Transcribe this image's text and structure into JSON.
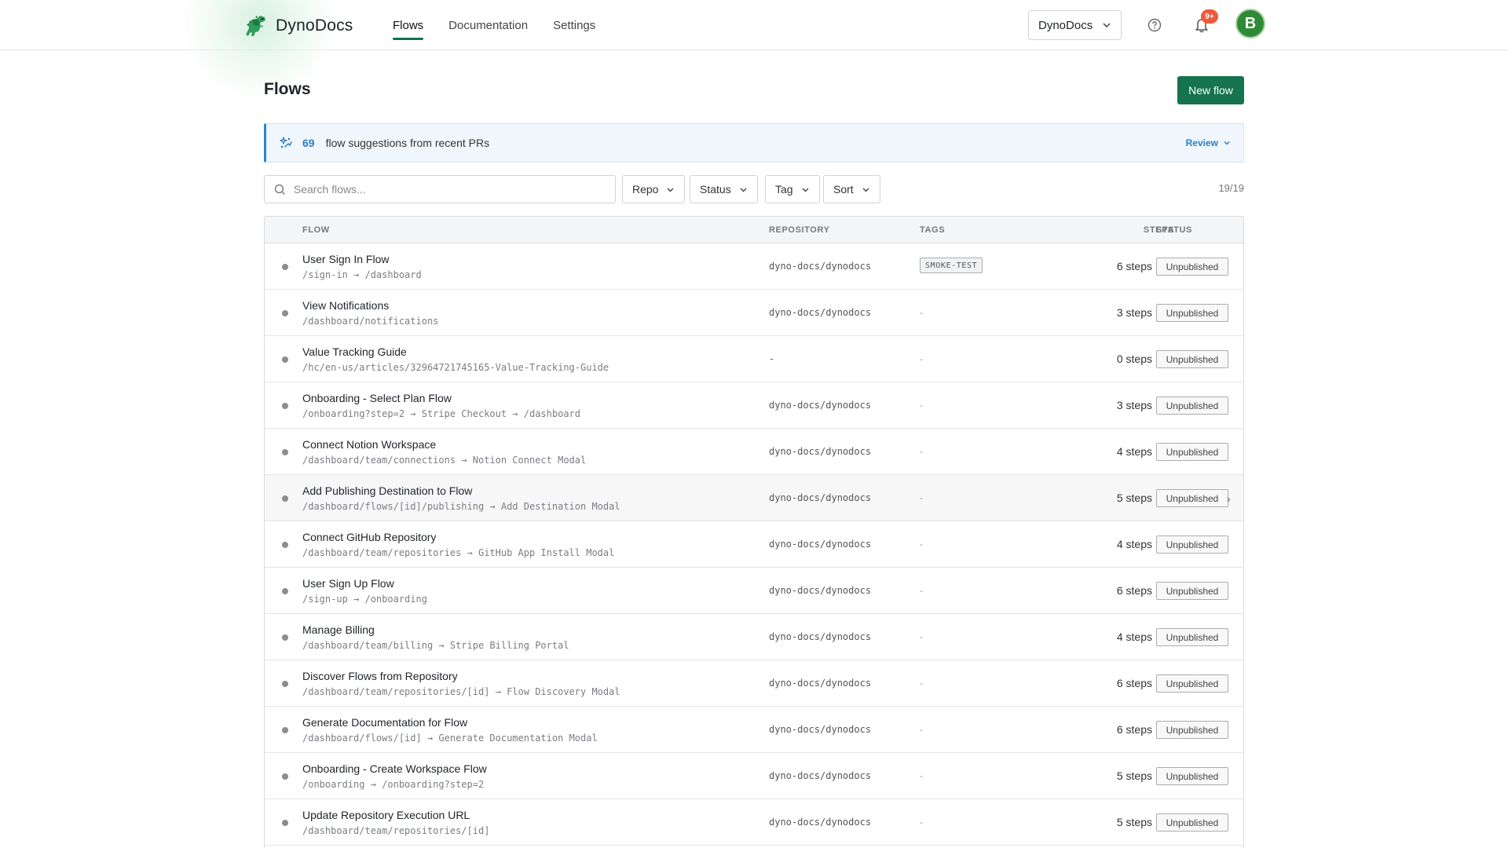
{
  "app": {
    "name": "DynoDocs"
  },
  "nav": {
    "items": [
      {
        "label": "Flows",
        "active": true
      },
      {
        "label": "Documentation",
        "active": false
      },
      {
        "label": "Settings",
        "active": false
      }
    ]
  },
  "header": {
    "workspace": "DynoDocs",
    "notification_badge": "9+",
    "avatar_initial": "B",
    "accent_color": "#157350"
  },
  "page": {
    "title": "Flows",
    "new_flow_label": "New flow"
  },
  "banner": {
    "count": "69",
    "text": "flow suggestions from recent PRs",
    "action": "Review"
  },
  "toolbar": {
    "search_placeholder": "Search flows...",
    "filters": [
      "Repo",
      "Status",
      "Tag",
      "Sort"
    ],
    "count": "19/19"
  },
  "table": {
    "headers": {
      "flow": "FLOW",
      "repository": "REPOSITORY",
      "tags": "TAGS",
      "steps": "STEPS",
      "status": "STATUS"
    },
    "rows": [
      {
        "name": "User Sign In Flow",
        "path": "/sign-in → /dashboard",
        "repo": "dyno-docs/dynodocs",
        "tag": "SMOKE-TEST",
        "steps": "6 steps",
        "status": "Unpublished"
      },
      {
        "name": "View Notifications",
        "path": "/dashboard/notifications",
        "repo": "dyno-docs/dynodocs",
        "tag": "",
        "steps": "3 steps",
        "status": "Unpublished"
      },
      {
        "name": "Value Tracking Guide",
        "path": "/hc/en-us/articles/32964721745165-Value-Tracking-Guide",
        "repo": "-",
        "tag": "",
        "steps": "0 steps",
        "status": "Unpublished"
      },
      {
        "name": "Onboarding - Select Plan Flow",
        "path": "/onboarding?step=2 → Stripe Checkout → /dashboard",
        "repo": "dyno-docs/dynodocs",
        "tag": "",
        "steps": "3 steps",
        "status": "Unpublished"
      },
      {
        "name": "Connect Notion Workspace",
        "path": "/dashboard/team/connections → Notion Connect Modal",
        "repo": "dyno-docs/dynodocs",
        "tag": "",
        "steps": "4 steps",
        "status": "Unpublished"
      },
      {
        "name": "Add Publishing Destination to Flow",
        "path": "/dashboard/flows/[id]/publishing → Add Destination Modal",
        "repo": "dyno-docs/dynodocs",
        "tag": "",
        "steps": "5 steps",
        "status": "Unpublished"
      },
      {
        "name": "Connect GitHub Repository",
        "path": "/dashboard/team/repositories → GitHub App Install Modal",
        "repo": "dyno-docs/dynodocs",
        "tag": "",
        "steps": "4 steps",
        "status": "Unpublished"
      },
      {
        "name": "User Sign Up Flow",
        "path": "/sign-up → /onboarding",
        "repo": "dyno-docs/dynodocs",
        "tag": "",
        "steps": "6 steps",
        "status": "Unpublished"
      },
      {
        "name": "Manage Billing",
        "path": "/dashboard/team/billing → Stripe Billing Portal",
        "repo": "dyno-docs/dynodocs",
        "tag": "",
        "steps": "4 steps",
        "status": "Unpublished"
      },
      {
        "name": "Discover Flows from Repository",
        "path": "/dashboard/team/repositories/[id] → Flow Discovery Modal",
        "repo": "dyno-docs/dynodocs",
        "tag": "",
        "steps": "6 steps",
        "status": "Unpublished"
      },
      {
        "name": "Generate Documentation for Flow",
        "path": "/dashboard/flows/[id] → Generate Documentation Modal",
        "repo": "dyno-docs/dynodocs",
        "tag": "",
        "steps": "6 steps",
        "status": "Unpublished"
      },
      {
        "name": "Onboarding - Create Workspace Flow",
        "path": "/onboarding → /onboarding?step=2",
        "repo": "dyno-docs/dynodocs",
        "tag": "",
        "steps": "5 steps",
        "status": "Unpublished"
      },
      {
        "name": "Update Repository Execution URL",
        "path": "/dashboard/team/repositories/[id]",
        "repo": "dyno-docs/dynodocs",
        "tag": "",
        "steps": "5 steps",
        "status": "Unpublished"
      }
    ],
    "empty_tag": "-"
  }
}
